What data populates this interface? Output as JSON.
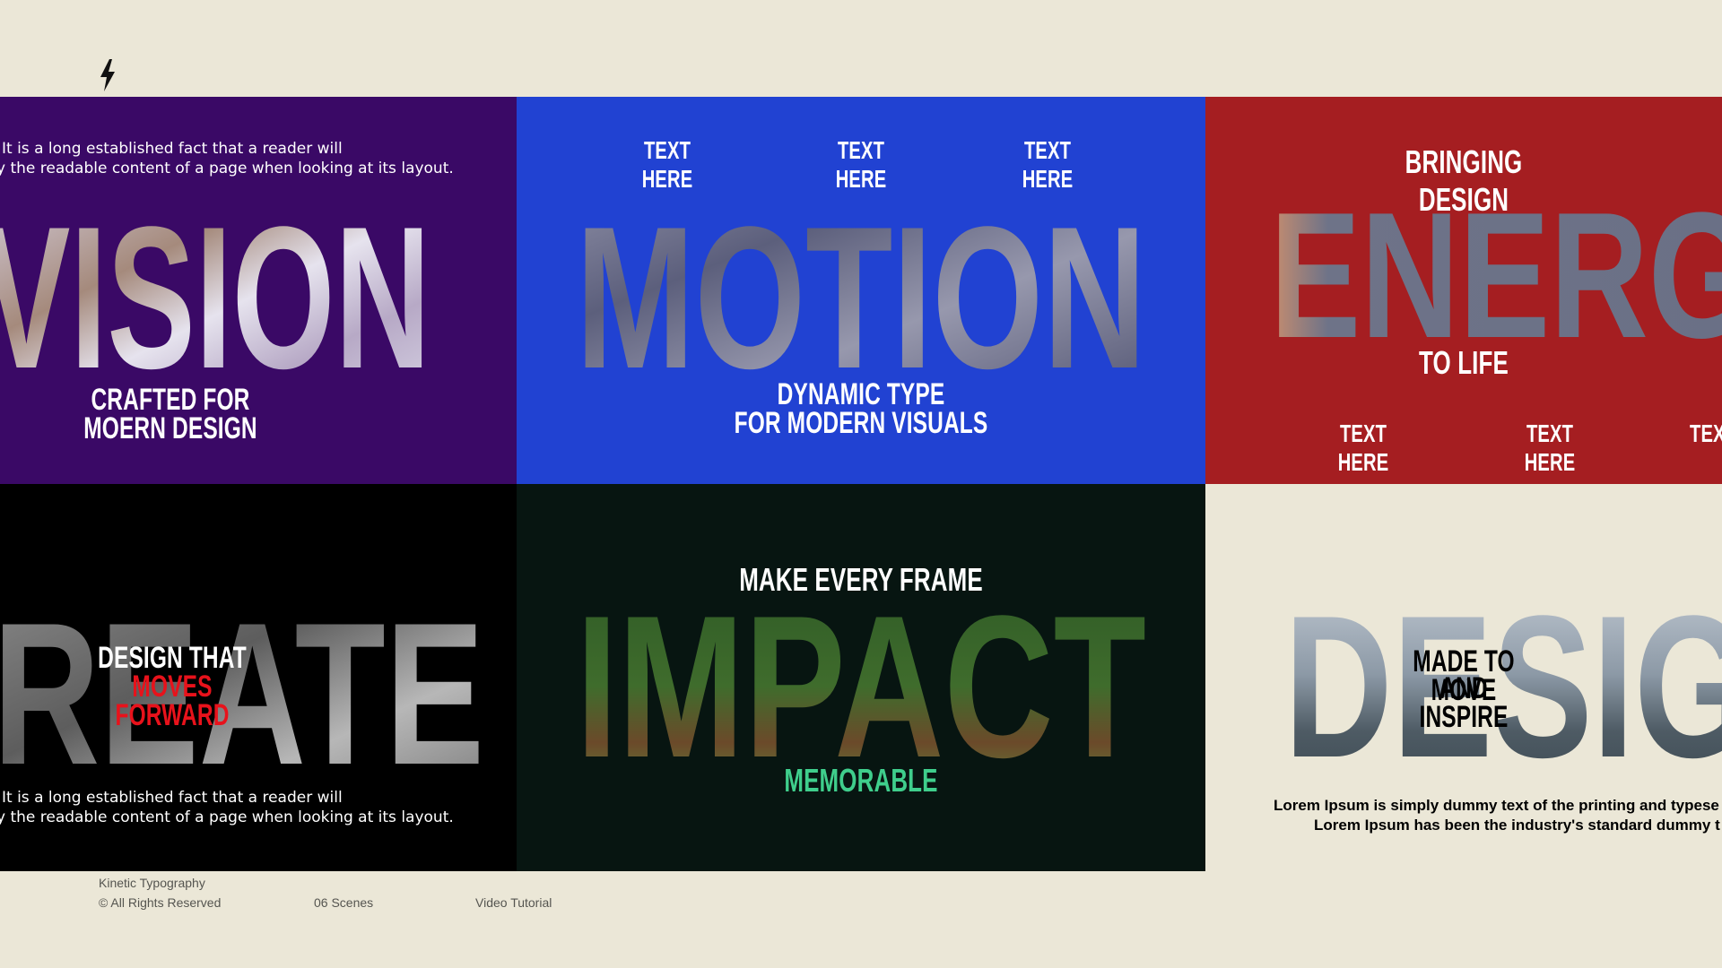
{
  "colors": {
    "background": "#ebe7d7",
    "purple": "#3a0966",
    "blue": "#2142d2",
    "red": "#a51e21",
    "black": "#000000",
    "dark_green": "#071511",
    "accent_red": "#e8121b",
    "accent_green": "#3fce8c"
  },
  "logo": {
    "icon": "lightning-bolt-icon"
  },
  "scenes": {
    "vision": {
      "word": "VISION",
      "body_line1": "It is a long established fact that a reader will",
      "body_line2": "y the readable content of a page when looking at its layout.",
      "tagline1": "CRAFTED FOR",
      "tagline2": "MOERN DESIGN"
    },
    "motion": {
      "top_labels": [
        "TEXT HERE",
        "TEXT HERE",
        "TEXT HERE"
      ],
      "word": "MOTION",
      "tagline1": "DYNAMIC TYPE",
      "tagline2": "FOR MODERN VISUALS"
    },
    "energy": {
      "top_line": "BRINGING DESIGN",
      "word": "ENERG",
      "bottom_line": "TO LIFE",
      "labels": [
        "TEXT HERE",
        "TEXT HERE",
        "TEX"
      ]
    },
    "create": {
      "word": "REATE",
      "tagline1": "DESIGN THAT",
      "tagline2": "MOVES FORWARD",
      "body_line1": "It is a long established fact that a reader will",
      "body_line2": "y the readable content of a page when looking at its layout."
    },
    "impact": {
      "top_line": "MAKE EVERY FRAME",
      "word": "IMPACT",
      "bottom_line": "MEMORABLE"
    },
    "design": {
      "word": "DESIG",
      "tagline1": "MADE TO MOVE",
      "tagline2": "AND INSPIRE",
      "body_line1": "Lorem Ipsum is simply dummy text of the printing and typese",
      "body_line2": "Lorem Ipsum has been the industry's standard dummy t"
    }
  },
  "footer": {
    "title": "Kinetic Typography",
    "rights": "© All Rights Reserved",
    "scenes": "06 Scenes",
    "tutorial": "Video Tutorial"
  }
}
